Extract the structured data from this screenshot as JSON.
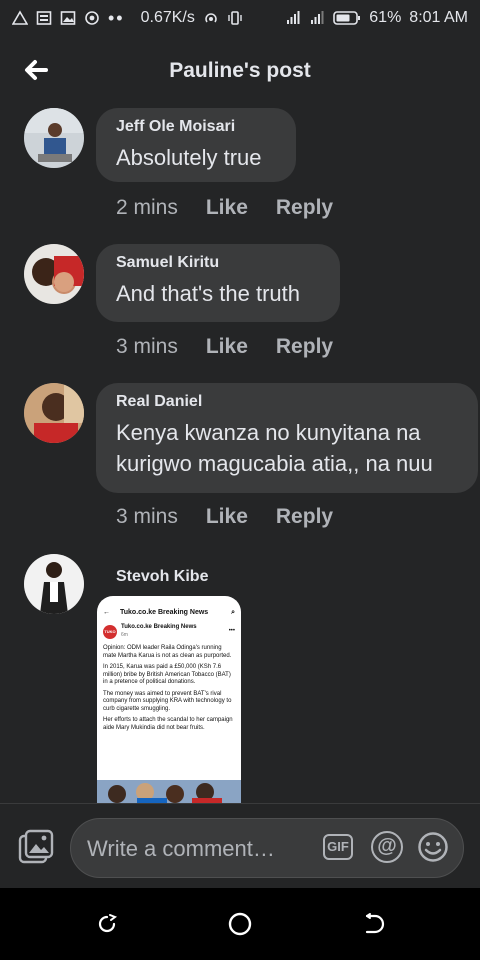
{
  "status": {
    "speed": "0.67K/s",
    "battery": "61%",
    "time": "8:01 AM"
  },
  "header": {
    "title": "Pauline's post"
  },
  "comments": [
    {
      "author": "Jeff Ole Moisari",
      "text": "Absolutely true",
      "time": "2 mins",
      "like": "Like",
      "reply": "Reply"
    },
    {
      "author": "Samuel Kiritu",
      "text": "And that's the truth",
      "time": "3 mins",
      "like": "Like",
      "reply": "Reply"
    },
    {
      "author": "Real Daniel",
      "text": "Kenya kwanza no kunyitana na kurigwo magucabia atia,, na nuu",
      "time": "3 mins",
      "like": "Like",
      "reply": "Reply"
    },
    {
      "author": "Stevoh Kibe"
    }
  ],
  "attachment": {
    "app_title": "Tuko.co.ke Breaking News",
    "page_name": "Tuko.co.ke Breaking News",
    "page_time": "6m",
    "logo": "TUKO",
    "para1": "Opinion: ODM leader Raila Odinga's running mate Martha Karua is not as clean as purported.",
    "para2": "In 2015, Karua was paid a £50,000 (KSh 7.6 million) bribe by British American Tobacco (BAT) in a pretence of political donations.",
    "para3": "The money was aimed to prevent BAT's rival company from supplying KRA with technology to curb cigarette smuggling.",
    "para4": "Her efforts to attach the scandal to her campaign aide Mary Mukindia did not bear fruits."
  },
  "composer": {
    "placeholder": "Write a comment…",
    "gif": "GIF",
    "at": "@"
  },
  "colors": {
    "background": "#242526",
    "bubble": "#3a3b3c",
    "text": "#e4e6eb",
    "muted": "#b0b3b8"
  }
}
